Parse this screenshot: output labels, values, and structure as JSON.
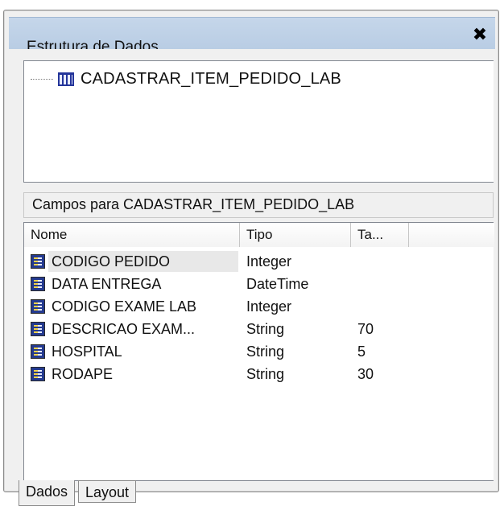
{
  "window": {
    "title": "Estrutura de Dados",
    "close_label": "✕"
  },
  "tree": {
    "item_label": "CADASTRAR_ITEM_PEDIDO_LAB",
    "item_icon": "table-icon"
  },
  "fields": {
    "label": "Campos para CADASTRAR_ITEM_PEDIDO_LAB",
    "columns": [
      "Nome",
      "Tipo",
      "Ta...",
      ""
    ],
    "rows": [
      {
        "nome": "CODIGO PEDIDO",
        "tipo": "Integer",
        "tamanho": ""
      },
      {
        "nome": "DATA ENTREGA",
        "tipo": "DateTime",
        "tamanho": ""
      },
      {
        "nome": "CODIGO EXAME LAB",
        "tipo": "Integer",
        "tamanho": ""
      },
      {
        "nome": "DESCRICAO EXAM...",
        "tipo": "String",
        "tamanho": "70"
      },
      {
        "nome": "HOSPITAL",
        "tipo": "String",
        "tamanho": "5"
      },
      {
        "nome": "RODAPE",
        "tipo": "String",
        "tamanho": "30"
      }
    ]
  },
  "tabs": [
    {
      "label": "Dados",
      "active": true
    },
    {
      "label": "Layout",
      "active": false
    }
  ]
}
